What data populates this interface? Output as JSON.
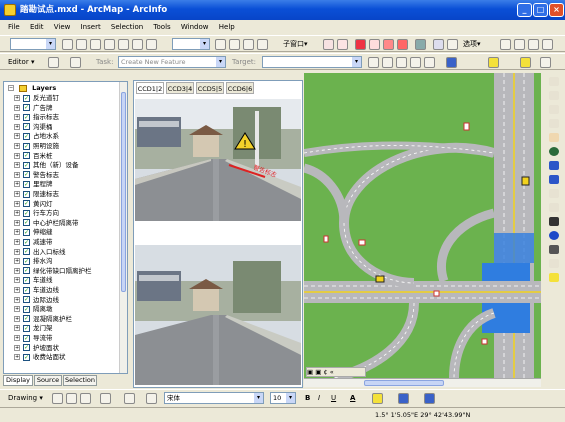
{
  "window": {
    "title": "踏勘试点.mxd - ArcMap - ArcInfo",
    "controls": [
      "_",
      "□",
      "×"
    ]
  },
  "menu": [
    "File",
    "Edit",
    "View",
    "Insert",
    "Selection",
    "Tools",
    "Window",
    "Help"
  ],
  "toolbar1": {
    "scale_value": "",
    "layer_value": "",
    "window_label": "子窗口▾",
    "options_label": "选项▾"
  },
  "toolbar2": {
    "editor_label": "Editor ▾",
    "task_label": "Task:",
    "task_value": "Create New Feature",
    "target_label": "Target:",
    "target_value": ""
  },
  "toc": {
    "root_label": "Layers",
    "layers": [
      "反光道钉",
      "广告牌",
      "指示标志",
      "沟渠桶",
      "占地水系",
      "照明设施",
      "百米桩",
      "其他（新）设备",
      "警告标志",
      "里程牌",
      "限速标志",
      "黄闪灯",
      "行车方向",
      "中心护栏隔离带",
      "伸缩缝",
      "减速带",
      "出入口标线",
      "排水沟",
      "绿化带缺口隔离护栏",
      "车道线",
      "车道边线",
      "边际边线",
      "隔离墩",
      "混凝隔离护栏",
      "龙门架",
      "导流带",
      "护坡面状",
      "收费站面状"
    ]
  },
  "toc_tabs": [
    "Display",
    "Source",
    "Selection"
  ],
  "photo_tabs": [
    "CCD1|2",
    "CCD3|4",
    "CCD5|5",
    "CCD6|6"
  ],
  "drawing_bar": {
    "drawing_label": "Drawing ▾",
    "font_name": "宋体",
    "font_size": "10",
    "bold": "B",
    "italic": "I",
    "underline": "U",
    "font_color": "A"
  },
  "map_tabs": [
    "▣",
    "▣",
    "¢",
    "«"
  ],
  "status": {
    "coordinates": "1.5° 1'5.05\"E  29° 42'43.99\"N"
  },
  "colors": {
    "titlebar": "#0a4fd6",
    "map_grass": "#6bb24e",
    "road": "#b8b8bc",
    "lane_yellow": "#f2d21d",
    "lane_blue": "#2f7de0"
  }
}
